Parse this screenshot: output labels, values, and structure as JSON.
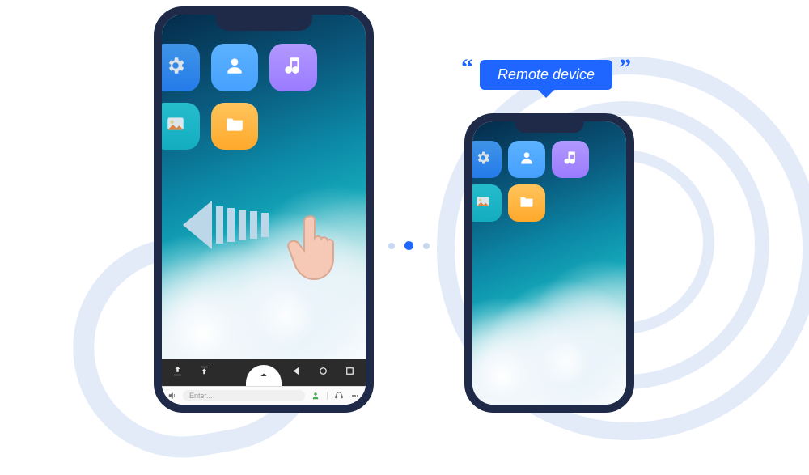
{
  "label": {
    "text": "Remote device"
  },
  "apps": {
    "settings": "Settings",
    "contacts": "Contacts",
    "music": "Music",
    "gallery": "Gallery",
    "files": "Files"
  },
  "swipe": {
    "direction": "left"
  },
  "chat": {
    "placeholder": "Enter...",
    "sound_icon": "sound-icon",
    "send_icon": "send-user-icon",
    "support_icon": "support-headset-icon",
    "more_icon": "more-dots-icon"
  },
  "toolbar": {
    "upload_icon": "upload-icon",
    "download_icon": "download-icon",
    "expand_icon": "expand-up-icon",
    "back_icon": "nav-back-icon",
    "home_icon": "nav-home-icon",
    "recents_icon": "nav-recents-icon"
  },
  "connection": {
    "dots": 3,
    "active_index": 1
  }
}
